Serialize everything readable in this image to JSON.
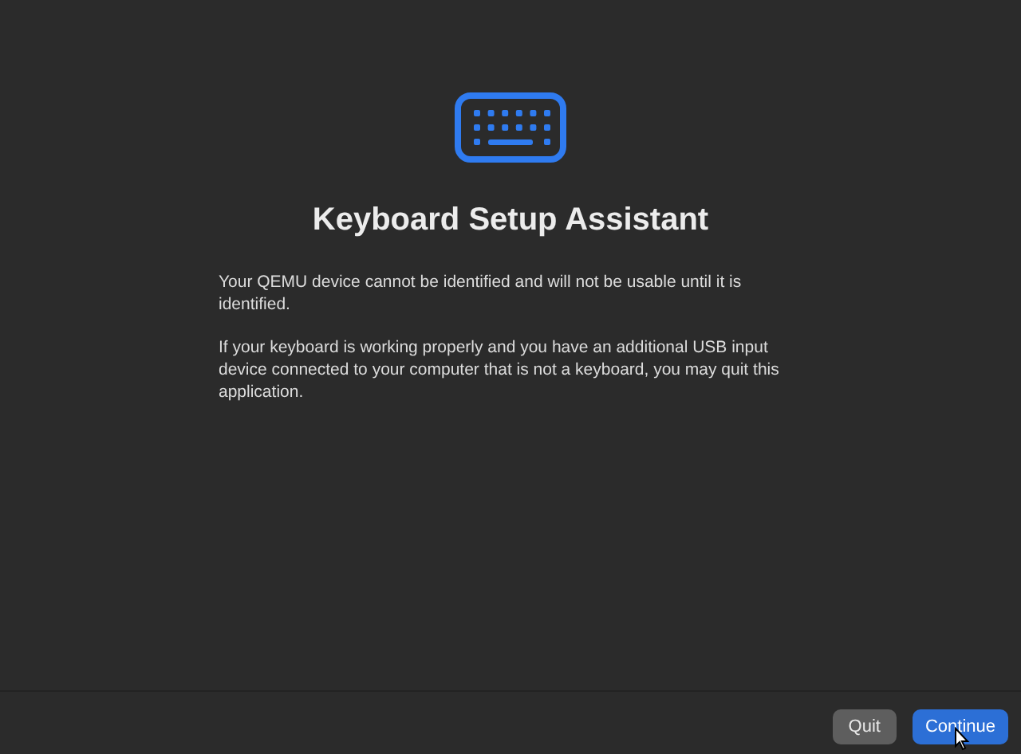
{
  "title": "Keyboard Setup Assistant",
  "paragraphs": [
    "Your QEMU device cannot be identified and will not be usable until it is identified.",
    "If your keyboard is working properly and you have an additional USB input device connected to your computer that is not a keyboard, you may quit this application."
  ],
  "buttons": [
    {
      "label": "Quit",
      "default": false
    },
    {
      "label": "Continue",
      "default": true
    }
  ]
}
